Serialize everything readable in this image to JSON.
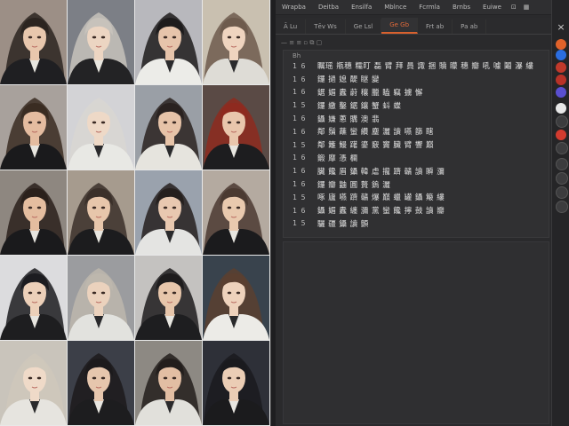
{
  "menubar": {
    "items": [
      "Wrapba",
      "Deitba",
      "Ensilfa",
      "Mblnce",
      "Fcrmla",
      "Brnbs",
      "Euiwe"
    ],
    "extra": "⊡",
    "extra2": "▦"
  },
  "tabs": [
    {
      "label": "Ā Lu",
      "active": false
    },
    {
      "label": "Tēv Ws",
      "active": false
    },
    {
      "label": "Ge Lsl",
      "active": false
    },
    {
      "label": "Ge Gb",
      "active": true
    },
    {
      "label": "Frt ab",
      "active": false
    },
    {
      "label": "Pa ab",
      "active": false
    }
  ],
  "toolbar": {
    "label": "— ≡ ≡ ▫ ⧉ ▢"
  },
  "content": {
    "header": "Bh",
    "lines": [
      {
        "num": "1 6",
        "text": "瞩瑶 瓶穗 糯盯 磊 臂 拜 員 諏 捆 贖 矇 穗 瓣 吼 噱 鬮 瀑 縷"
      },
      {
        "num": "1 6",
        "text": "鑼 撾 媳 醍 瞇 變"
      },
      {
        "num": "1 6",
        "text": "鋸 媚 蠹 蔚 穰 臘 瞌 竊 擄 懈"
      },
      {
        "num": "1 5",
        "text": "鑼 繳 鑿 鋸 鑲 蟹 蚪 蝶"
      },
      {
        "num": "1 6",
        "text": "鑷 嫌 蔥 購 澳 翡"
      },
      {
        "num": "1 6",
        "text": "鄰 鬚 蘸 蠻 纘 塵 灑 讀 嚥 篩 瞎"
      },
      {
        "num": "1 5",
        "text": "鄰 籬 鰻 躇 鎏 竅 竇 臟 臂 響 巔"
      },
      {
        "num": "1 6",
        "text": "鍛 靡 憑 欄"
      },
      {
        "num": "1 6",
        "text": "臟 饞 眉 鑷 韓 虐 攏 躋 贛 讀 瞬 瀰"
      },
      {
        "num": "1 6",
        "text": "鑼 瓣 鼬 圓 贅 鎢 灑"
      },
      {
        "num": "1 5",
        "text": "啄 廬 嚥 躋 贛 爆 巔 蠟 罐 鑷 簸 縷"
      },
      {
        "num": "1 6",
        "text": "鑷 媚 蠹 纏 瀰 黨 蠻 饞 擰 鼓 讀 瓣"
      },
      {
        "num": "1 5",
        "text": "驪 疆 鑷 讀 顫"
      }
    ]
  },
  "sidebar": {
    "close": "×",
    "icons": [
      {
        "name": "orange-circle-icon",
        "color": "#e0622a"
      },
      {
        "name": "blue-circle-icon",
        "color": "#2b6de0"
      },
      {
        "name": "red-dot-icon",
        "color": "#c0392b"
      },
      {
        "name": "red-dot-icon-2",
        "color": "#b83228"
      },
      {
        "name": "purple-square-icon",
        "color": "#5a4fd0"
      },
      {
        "name": "white-drop-icon",
        "color": "#e8e8e8"
      },
      {
        "name": "gray-icon-1",
        "color": "#3c3c3e"
      },
      {
        "name": "red-stop-icon",
        "color": "#d23b2f"
      },
      {
        "name": "gray-icon-2",
        "color": "#3c3c3e"
      },
      {
        "name": "gray-icon-3",
        "color": "#3c3c3e"
      },
      {
        "name": "gray-icon-4",
        "color": "#3c3c3e"
      },
      {
        "name": "gray-icon-5",
        "color": "#3c3c3e"
      },
      {
        "name": "gray-icon-6",
        "color": "#3c3c3e"
      }
    ]
  },
  "gallery": {
    "tiles": [
      {
        "hair": "#2b2420",
        "skin": "#e8c7ad",
        "bg": "#9c8f86",
        "cloth": "#1f1f22"
      },
      {
        "hair": "#c7c2bb",
        "skin": "#ecd5c2",
        "bg": "#7c7f86",
        "cloth": "#232325"
      },
      {
        "hair": "#1d1b1c",
        "skin": "#e6c4ab",
        "bg": "#b8b8bd",
        "cloth": "#ecece8"
      },
      {
        "hair": "#6e5b4d",
        "skin": "#efd4bf",
        "bg": "#c9c0b0",
        "cloth": "#dedcd6"
      },
      {
        "hair": "#3a2c22",
        "skin": "#e4bca0",
        "bg": "#a8a19c",
        "cloth": "#1a1a1c"
      },
      {
        "hair": "#d8d6d2",
        "skin": "#eed9c7",
        "bg": "#d3d3d6",
        "cloth": "#e8e8e4"
      },
      {
        "hair": "#2a2220",
        "skin": "#e6c3a8",
        "bg": "#9a9fa6",
        "cloth": "#e6e4de"
      },
      {
        "hair": "#8e2a1f",
        "skin": "#e9c6ac",
        "bg": "#5a4a45",
        "cloth": "#1d1d1f"
      },
      {
        "hair": "#2a201b",
        "skin": "#e4bd9f",
        "bg": "#8e8780",
        "cloth": "#1a1a1c"
      },
      {
        "hair": "#3b302a",
        "skin": "#e7c6ab",
        "bg": "#a69b8e",
        "cloth": "#1c1c1e"
      },
      {
        "hair": "#26201e",
        "skin": "#e8c8b0",
        "bg": "#9aa2ad",
        "cloth": "#e4e4e2"
      },
      {
        "hair": "#4b3a31",
        "skin": "#e9c9ae",
        "bg": "#b4aaa0",
        "cloth": "#1b1b1d"
      },
      {
        "hair": "#1c1c20",
        "skin": "#ecd0b9",
        "bg": "#dcdcde",
        "cloth": "#1e1e20"
      },
      {
        "hair": "#bdb7ad",
        "skin": "#ebd2bd",
        "bg": "#9b9c9f",
        "cloth": "#e2e2de"
      },
      {
        "hair": "#1e1c1d",
        "skin": "#e7c6ab",
        "bg": "#c4c2c0",
        "cloth": "#1e1e20"
      },
      {
        "hair": "#5a3f30",
        "skin": "#eed2bc",
        "bg": "#39434d",
        "cloth": "#ecebe7"
      },
      {
        "hair": "#cfc8bb",
        "skin": "#efdac8",
        "bg": "#c9c4bb",
        "cloth": "#e6e4df"
      },
      {
        "hair": "#1c1a1c",
        "skin": "#e6c6ad",
        "bg": "#3c3f48",
        "cloth": "#1d1d1f"
      },
      {
        "hair": "#231e1c",
        "skin": "#e2bea3",
        "bg": "#8d8983",
        "cloth": "#e1e0db"
      },
      {
        "hair": "#1a1a1e",
        "skin": "#ebcdb5",
        "bg": "#2e3038",
        "cloth": "#1b1b1d"
      }
    ]
  }
}
